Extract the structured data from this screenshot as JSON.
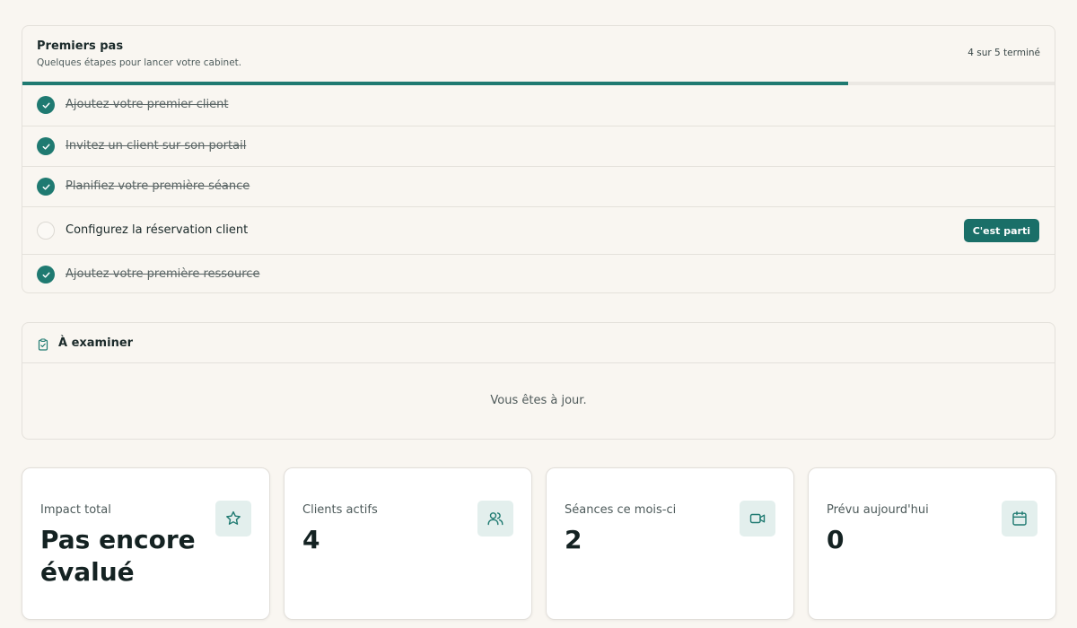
{
  "getting_started": {
    "title": "Premiers pas",
    "subtitle": "Quelques étapes pour lancer votre cabinet.",
    "progress_text": "4 sur 5 terminé",
    "progress_fraction": 0.8,
    "steps": [
      {
        "label": "Ajoutez votre premier client",
        "done": true
      },
      {
        "label": "Invitez un client sur son portail",
        "done": true
      },
      {
        "label": "Planifiez votre première séance",
        "done": true
      },
      {
        "label": "Configurez la réservation client",
        "done": false,
        "action": "C'est parti"
      },
      {
        "label": "Ajoutez votre première ressource",
        "done": true
      }
    ]
  },
  "review": {
    "title": "À examiner",
    "icon": "clipboard-check-icon",
    "empty_text": "Vous êtes à jour."
  },
  "stats": [
    {
      "label": "Impact total",
      "value": "Pas encore évalué",
      "icon": "star-icon"
    },
    {
      "label": "Clients actifs",
      "value": "4",
      "icon": "users-icon"
    },
    {
      "label": "Séances ce mois-ci",
      "value": "2",
      "icon": "video-icon"
    },
    {
      "label": "Prévu aujourd'hui",
      "value": "0",
      "icon": "calendar-icon"
    }
  ],
  "colors": {
    "accent": "#1f7a71",
    "background": "#f9f6f1",
    "icon_tile": "#e3efed"
  }
}
